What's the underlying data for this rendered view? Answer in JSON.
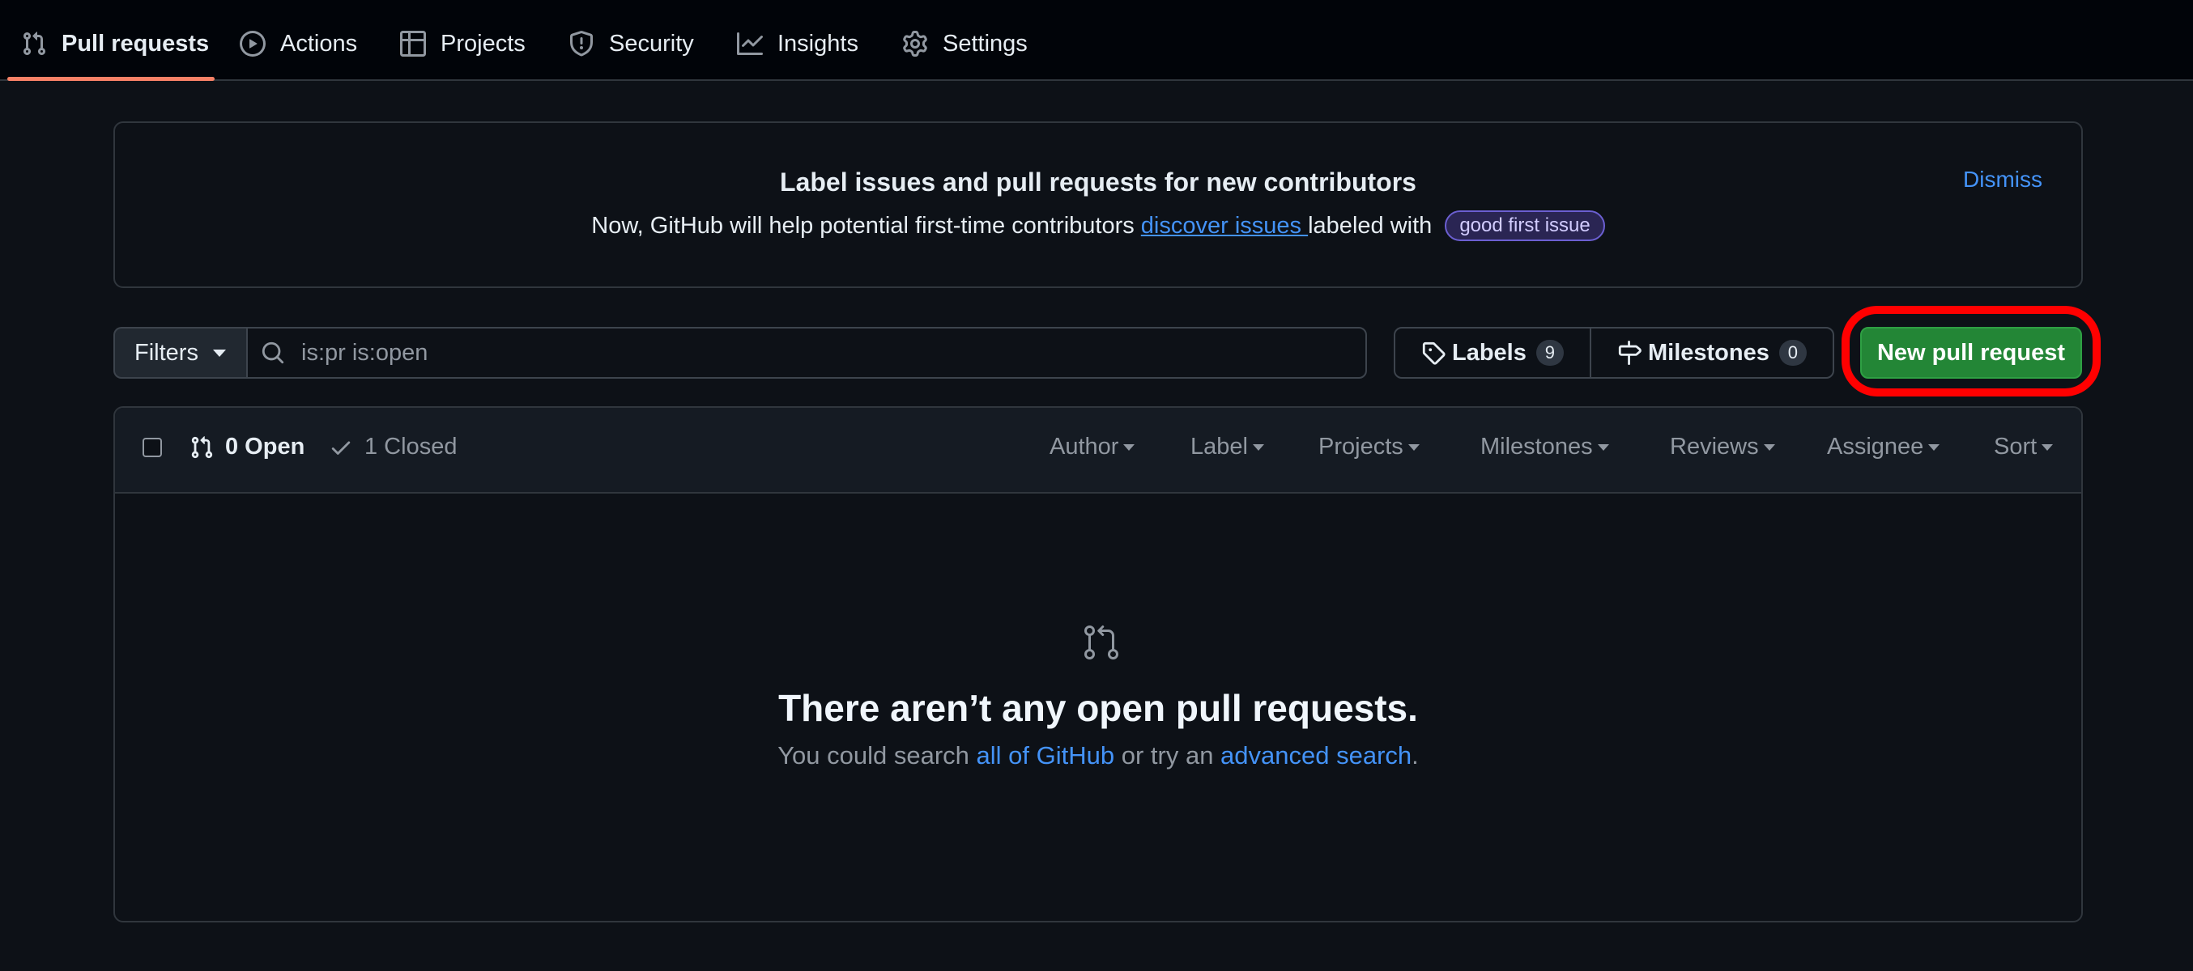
{
  "nav": {
    "tabs": [
      {
        "label": "Pull requests",
        "icon": "git-pull-request-icon",
        "active": true
      },
      {
        "label": "Actions",
        "icon": "play-icon"
      },
      {
        "label": "Projects",
        "icon": "table-icon"
      },
      {
        "label": "Security",
        "icon": "shield-icon"
      },
      {
        "label": "Insights",
        "icon": "graph-icon"
      },
      {
        "label": "Settings",
        "icon": "gear-icon"
      }
    ]
  },
  "banner": {
    "title": "Label issues and pull requests for new contributors",
    "text_before": "Now, GitHub will help potential first-time contributors ",
    "link": "discover issues ",
    "text_after": "labeled with",
    "label": "good first issue",
    "dismiss": "Dismiss"
  },
  "filters": {
    "button": "Filters",
    "search_placeholder": "is:pr is:open",
    "labels": {
      "label": "Labels",
      "count": "9"
    },
    "milestones": {
      "label": "Milestones",
      "count": "0"
    },
    "new_pr": "New pull request"
  },
  "list": {
    "open": "0 Open",
    "closed": "1 Closed",
    "header_filters": [
      "Author",
      "Label",
      "Projects",
      "Milestones",
      "Reviews",
      "Assignee",
      "Sort"
    ]
  },
  "empty": {
    "title": "There aren’t any open pull requests.",
    "text1": "You could search ",
    "link1": "all of GitHub",
    "text2": " or try an ",
    "link2": "advanced search",
    "text3": "."
  },
  "colors": {
    "accent_link": "#4493f8",
    "primary_button": "#238636",
    "tab_underline": "#f78166",
    "highlight": "#ff0000"
  }
}
